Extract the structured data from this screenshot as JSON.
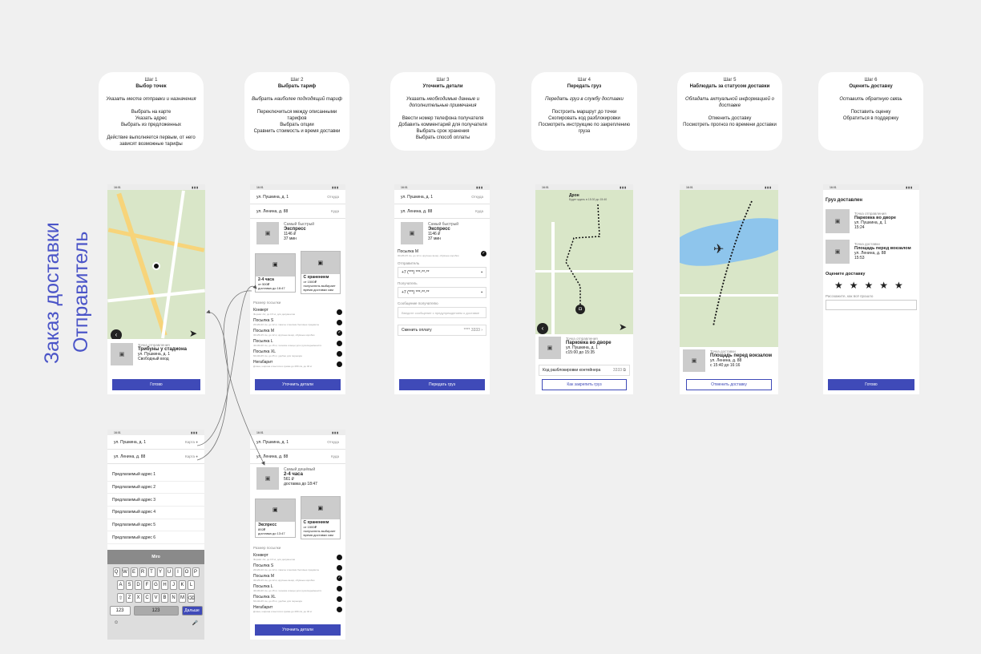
{
  "title": {
    "line1": "Заказ доставки",
    "line2": "Отправитель"
  },
  "steps": [
    {
      "step": "Шаг 1",
      "name": "Выбор точек",
      "goal": "Указать места отправки и назначения",
      "actions": [
        "Выбрать на карте",
        "Указать адрес",
        "Выбрать из предложенных"
      ],
      "note": "Действие выполняется первым, от него зависят возможные тарифы"
    },
    {
      "step": "Шаг 2",
      "name": "Выбрать тариф",
      "goal": "Выбрать наиболее подходящий тариф",
      "actions": [
        "Переключиться между описанными тарифов",
        "Выбрать опции",
        "Сравнить стоимость и время доставки"
      ],
      "note": ""
    },
    {
      "step": "Шаг 3",
      "name": "Уточнить детали",
      "goal": "Указать необходимые данные и дополнительные примечания",
      "actions": [
        "Ввести номер телефона получателя",
        "Добавить комментарий для получателя",
        "Выбрать срок хранения",
        "Выбрать способ оплаты"
      ],
      "note": ""
    },
    {
      "step": "Шаг 4",
      "name": "Передать груз",
      "goal": "Передать груз в службу доставки",
      "actions": [
        "Построить маршрут до точки",
        "Скопировать код разблокировки",
        "Посмотреть инструкцию по закреплению груза"
      ],
      "note": ""
    },
    {
      "step": "Шаг 5",
      "name": "Наблюдать за статусом доставки",
      "goal": "Обладать актуальной информацией о доставке",
      "actions": [
        "Отменить доставку",
        "Посмотреть прогноз по времени доставки"
      ],
      "note": ""
    },
    {
      "step": "Шаг 6",
      "name": "Оценить доставку",
      "goal": "Оставить обратную связь",
      "actions": [
        "Поставить оценку",
        "Обратиться в поддержку"
      ],
      "note": ""
    }
  ],
  "screens": {
    "time": "16:01",
    "s1": {
      "label": "Точка отправления",
      "place": "Трибуны у стадиона",
      "addr": "ул. Пушкина, д. 1",
      "extra": "Свободный вход",
      "button": "Готово"
    },
    "s2": {
      "from": "ул. Пушкина, д. 1",
      "from_hint": "Откуда",
      "to": "ул. Ленина, д. 88",
      "to_hint": "Куда",
      "tag": "Самый быстрый",
      "tariff": "Экспресс",
      "price": "1146 ₽",
      "time": "37 мин",
      "card1_name": "2-4 часа",
      "card1_price": "от 500₽",
      "card1_time": "доставка до 18:47",
      "card2_name": "С хранением",
      "card2_price": "от 1500₽",
      "card2_time": "получатель выбирает время доставки сам",
      "sizes_label": "Размер посылки",
      "button": "Уточнить детали"
    },
    "parcels": [
      {
        "name": "Конверт",
        "desc": "Формат А4, до 0.5 кг, для документов"
      },
      {
        "name": "Посылка S",
        "desc": "20х20х10 см, до 12 кг, пакеты и мелкие бытовые предметы"
      },
      {
        "name": "Посылка M",
        "desc": "30х25х15 см, до 12 кг, крупные вещи, обувные коробки"
      },
      {
        "name": "Посылка L",
        "desc": "40х30х20 см, до 15 кг, техника и вещи для грузоподъёмности"
      },
      {
        "name": "Посылка XL",
        "desc": "60х40х45 см, до 25 кг, удобно для переезда"
      },
      {
        "name": "Негабарит",
        "desc": "Длина, ширина и высота в сумме до 280 см, до 40 кг"
      }
    ],
    "s3": {
      "parcel": "Посылка M",
      "parcel_desc": "30х25х15 см, до 12 кг, крупные вещи, обувные коробки",
      "sender_label": "Отправитель",
      "phone": "+7 (***) ***-**-**",
      "receiver_label": "Получатель",
      "msg_label": "Сообщение получателю",
      "msg_ph": "Введите сообщение с предупреждением о доставке",
      "pay": "Сменить оплату",
      "card": "**** 3333",
      "button": "Передать груз"
    },
    "s4": {
      "map_title": "Дрон",
      "map_sub": "Будет ждать в 15:30 до 15:40",
      "label": "Точка отправления",
      "place": "Парковка во дворе",
      "addr": "ул. Пушкина, д. 1",
      "time": "с15:00 до 15:35",
      "code_label": "Код разблокировки контейнера",
      "code": "3333",
      "button": "Как закрепить груз"
    },
    "s5": {
      "label": "Точка доставки",
      "place": "Площадь перед вокзалом",
      "addr": "ул. Ленина, д. 88",
      "time": "с 15:40 до 16:16",
      "button": "Отменить доставку"
    },
    "s6": {
      "header": "Груз доставлен",
      "l1": "Точка отправления",
      "p1": "Парковка во дворе",
      "a1": "ул. Пушкина, д. 1",
      "t1": "15:24",
      "l2": "Точка доставки",
      "p2": "Площадь перед вокзалом",
      "a2": "ул. Ленина, д. 88",
      "t2": "15:53",
      "rate": "Оцените доставку",
      "stars": "★★★★★",
      "comment": "Расскажите, как всё прошло",
      "button": "Готово"
    },
    "s7": {
      "from": "ул. Пушкина, д. 1",
      "to": "ул. Ленина, д. 88",
      "hint": "Карта",
      "suggestions": [
        "Предлагаемый адрес 1",
        "Предлагаемый адрес 2",
        "Предлагаемый адрес 3",
        "Предлагаемый адрес 4",
        "Предлагаемый адрес 5",
        "Предлагаемый адрес 6"
      ],
      "kb_bar": "Miro",
      "row1": [
        "Q",
        "W",
        "E",
        "R",
        "T",
        "Y",
        "U",
        "I",
        "O",
        "P"
      ],
      "row2": [
        "A",
        "S",
        "D",
        "F",
        "G",
        "H",
        "J",
        "K",
        "L"
      ],
      "row3": [
        "Z",
        "X",
        "C",
        "V",
        "B",
        "N",
        "M"
      ],
      "k123": "123",
      "space": "123",
      "next": "Дальше"
    },
    "s8": {
      "tag": "Самый дешёвый",
      "tariff": "2-4 часа",
      "price": "561 ₽",
      "time": "доставка до 18:47",
      "card1_name": "Экспресс",
      "card1_price": "892₽",
      "card1_time": "доставка до 13:47",
      "card2_name": "С хранением",
      "card2_price": "от 1500₽",
      "card2_time": "получатель выбирает время доставки сам",
      "button": "Уточнить детали"
    }
  }
}
